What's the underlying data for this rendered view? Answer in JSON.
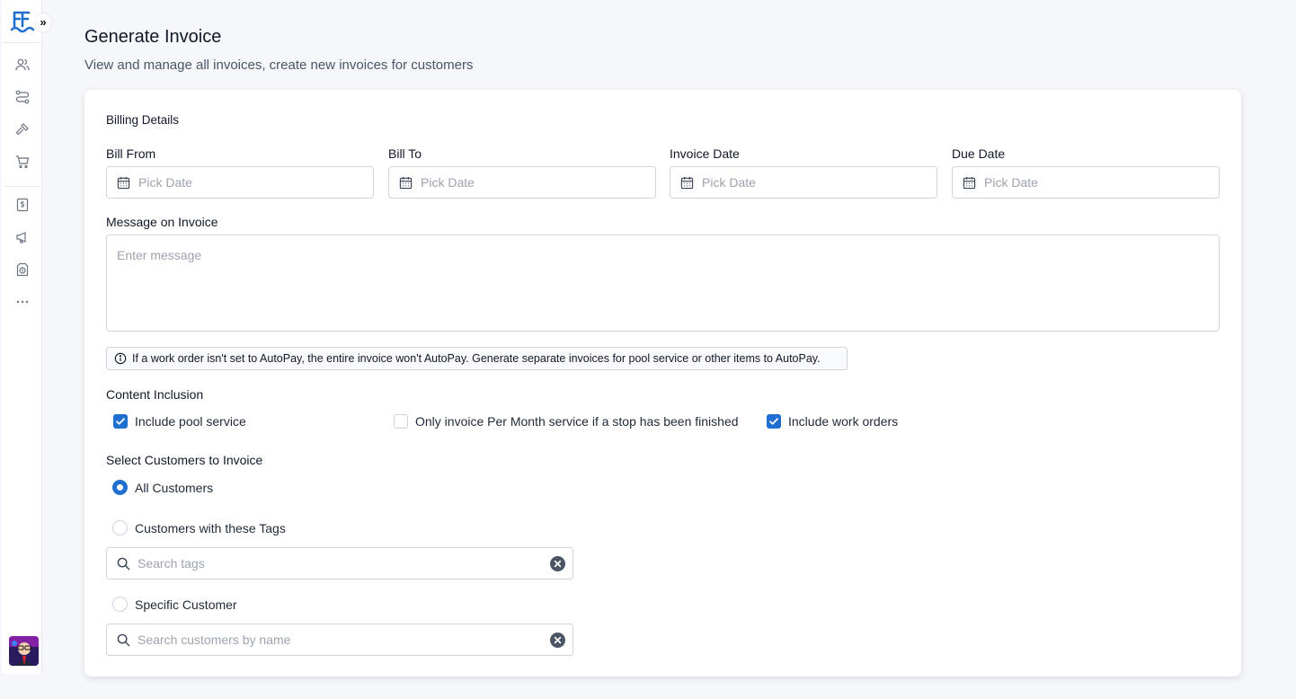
{
  "header": {
    "title": "Generate Invoice",
    "subtitle": "View and manage all invoices, create new invoices for customers"
  },
  "sidebar": {
    "expand_label": "»",
    "items": [
      {
        "icon": "users-icon"
      },
      {
        "icon": "routes-icon"
      },
      {
        "icon": "tools-icon"
      },
      {
        "icon": "cart-icon"
      },
      {
        "icon": "invoice-icon"
      },
      {
        "icon": "megaphone-icon"
      },
      {
        "icon": "document-dollar-icon"
      },
      {
        "icon": "more-icon"
      }
    ]
  },
  "billing": {
    "section_title": "Billing Details",
    "fields": [
      {
        "label": "Bill From",
        "placeholder": "Pick Date"
      },
      {
        "label": "Bill To",
        "placeholder": "Pick Date"
      },
      {
        "label": "Invoice Date",
        "placeholder": "Pick Date"
      },
      {
        "label": "Due Date",
        "placeholder": "Pick Date"
      }
    ],
    "message_label": "Message on Invoice",
    "message_placeholder": "Enter message"
  },
  "info_notice": "If a work order isn't set to AutoPay, the entire invoice won't AutoPay. Generate separate invoices for pool service or other items to AutoPay.",
  "content_inclusion": {
    "title": "Content Inclusion",
    "options": [
      {
        "label": "Include pool service",
        "checked": true
      },
      {
        "label": "Only invoice Per Month service if a stop has been finished",
        "checked": false
      },
      {
        "label": "Include work orders",
        "checked": true
      }
    ]
  },
  "customers": {
    "title": "Select Customers to Invoice",
    "options": [
      {
        "label": "All Customers",
        "selected": true
      },
      {
        "label": "Customers with these Tags",
        "selected": false
      },
      {
        "label": "Specific Customer",
        "selected": false
      }
    ],
    "tags_placeholder": "Search tags",
    "customer_placeholder": "Search customers by name"
  },
  "colors": {
    "accent": "#1f6fd1",
    "background": "#f5f7fb",
    "border": "#d1d5db"
  }
}
